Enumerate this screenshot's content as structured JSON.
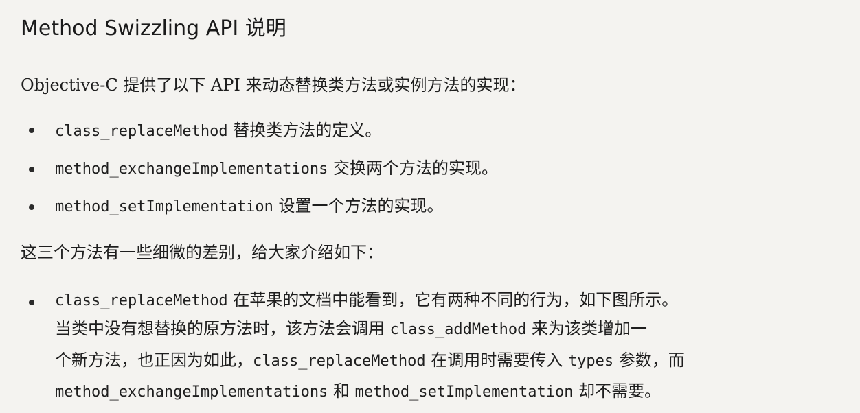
{
  "heading": "Method Swizzling API 说明",
  "intro": "Objective-C 提供了以下 API 来动态替换类方法或实例方法的实现：",
  "api_list": [
    {
      "code": "class_replaceMethod",
      "text": " 替换类方法的定义。"
    },
    {
      "code": "method_exchangeImplementations",
      "text": " 交换两个方法的实现。"
    },
    {
      "code": "method_setImplementation",
      "text": " 设置一个方法的实现。"
    }
  ],
  "summary": "这三个方法有一些细微的差别，给大家介绍如下：",
  "detail": {
    "line1": {
      "code": "class_replaceMethod",
      "text": " 在苹果的文档中能看到，它有两种不同的行为，如下图所示。"
    },
    "line2": {
      "pre": "当类中没有想替换的原方法时，该方法会调用 ",
      "code": "class_addMethod",
      "post": " 来为该类增加一"
    },
    "line3": {
      "pre": "个新方法，也正因为如此，",
      "code1": "class_replaceMethod",
      "mid": " 在调用时需要传入 ",
      "code2": "types",
      "post": " 参数，而"
    },
    "line4": {
      "code1": "method_exchangeImplementations",
      "mid": " 和 ",
      "code2": "method_setImplementation",
      "post": " 却不需要。"
    }
  }
}
